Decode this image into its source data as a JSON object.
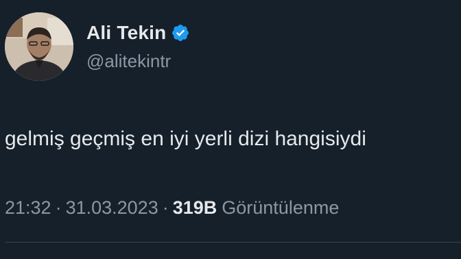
{
  "author": {
    "display_name": "Ali Tekin",
    "handle": "@alitekintr",
    "verified": true,
    "verified_icon": "verified-badge-icon"
  },
  "tweet": {
    "text": "gelmiş geçmiş en iyi yerli dizi hangisiydi",
    "time": "21:32",
    "separator": "·",
    "date": "31.03.2023",
    "views_count": "319B",
    "views_label": "Görüntülenme"
  },
  "colors": {
    "background": "#15202b",
    "primary_text": "#e7e9ea",
    "secondary_text": "#8b98a5",
    "verified_blue": "#1d9bf0",
    "divider": "#38444d"
  }
}
